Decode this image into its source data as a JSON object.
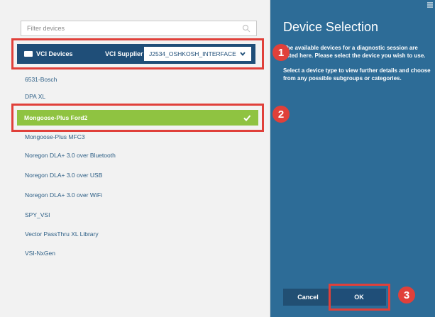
{
  "filter": {
    "placeholder": "Filter devices"
  },
  "header": {
    "title": "VCI Devices",
    "supplier_label": "VCI Supplier",
    "supplier_value": "J2534_OSHKOSH_INTERFACE"
  },
  "devices": [
    "6531-Bosch",
    "DPA XL",
    "Mongoose-Plus Ford2",
    "Mongoose-Plus MFC3",
    "Noregon DLA+ 3.0 over Bluetooth",
    "Noregon DLA+ 3.0 over USB",
    "Noregon DLA+ 3.0 over WiFi",
    "SPY_VSI",
    "Vector PassThru XL Library",
    "VSI-NxGen"
  ],
  "selected_device": "Mongoose-Plus Ford2",
  "right_panel": {
    "title": "Device Selection",
    "text1": "The available devices for a diagnostic session are listed here. Please select the device you wish to use.",
    "text2": "Select a device type to view further details and choose from any possible subgroups or categories."
  },
  "buttons": {
    "cancel": "Cancel",
    "ok": "OK"
  },
  "callouts": [
    "1",
    "2",
    "3"
  ],
  "colors": {
    "accent": "#2d6c97",
    "header": "#1f4e78",
    "selected": "#8fc341",
    "callout": "#e0403a"
  }
}
